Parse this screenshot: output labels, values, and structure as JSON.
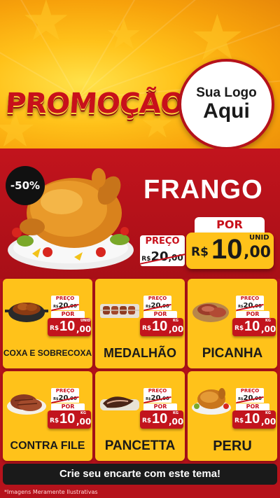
{
  "header": {
    "title": "PROMOÇÃO",
    "logo": {
      "line1": "Sua Logo",
      "line2": "Aqui"
    }
  },
  "hero": {
    "discount": "-50%",
    "product": "FRANGO",
    "por_label": "POR",
    "preco_label": "PREÇO",
    "old_price": {
      "currency": "R$",
      "int": "20",
      "dec": ",00"
    },
    "new_price": {
      "currency": "R$",
      "int": "10",
      "dec": ",00",
      "unit": "UNID"
    }
  },
  "products": [
    {
      "name": "COXA E SOBRECOXA",
      "preco_label": "PREÇO",
      "old": {
        "currency": "R$",
        "int": "20",
        "dec": ",00"
      },
      "por_label": "POR",
      "new": {
        "currency": "R$",
        "int": "10",
        "dec": ",00",
        "unit": "UNID"
      },
      "icon": "chicken-pot-icon"
    },
    {
      "name": "MEDALHÃO",
      "preco_label": "PREÇO",
      "old": {
        "currency": "R$",
        "int": "20",
        "dec": ",00"
      },
      "por_label": "POR",
      "new": {
        "currency": "R$",
        "int": "10",
        "dec": ",00",
        "unit": "KG"
      },
      "icon": "skewer-icon"
    },
    {
      "name": "PICANHA",
      "preco_label": "PREÇO",
      "old": {
        "currency": "R$",
        "int": "20",
        "dec": ",00"
      },
      "por_label": "POR",
      "new": {
        "currency": "R$",
        "int": "10",
        "dec": ",00",
        "unit": "KG"
      },
      "icon": "steak-board-icon"
    },
    {
      "name": "CONTRA FILE",
      "preco_label": "PREÇO",
      "old": {
        "currency": "R$",
        "int": "20",
        "dec": ",00"
      },
      "por_label": "POR",
      "new": {
        "currency": "R$",
        "int": "10",
        "dec": ",00",
        "unit": "KG"
      },
      "icon": "steak-icon"
    },
    {
      "name": "PANCETTA",
      "preco_label": "PREÇO",
      "old": {
        "currency": "R$",
        "int": "20",
        "dec": ",00"
      },
      "por_label": "POR",
      "new": {
        "currency": "R$",
        "int": "10",
        "dec": ",00",
        "unit": "KG"
      },
      "icon": "pancetta-icon"
    },
    {
      "name": "PERU",
      "preco_label": "PREÇO",
      "old": {
        "currency": "R$",
        "int": "20",
        "dec": ",00"
      },
      "por_label": "POR",
      "new": {
        "currency": "R$",
        "int": "10",
        "dec": ",00",
        "unit": "KG"
      },
      "icon": "roast-turkey-icon"
    }
  ],
  "footer": {
    "cta": "Crie seu encarte com este tema!",
    "disclaimer": "*Imagens Meramente Ilustrativas"
  },
  "colors": {
    "red": "#c2141d",
    "yellow": "#ffc21a",
    "dark": "#1a1a1a"
  }
}
